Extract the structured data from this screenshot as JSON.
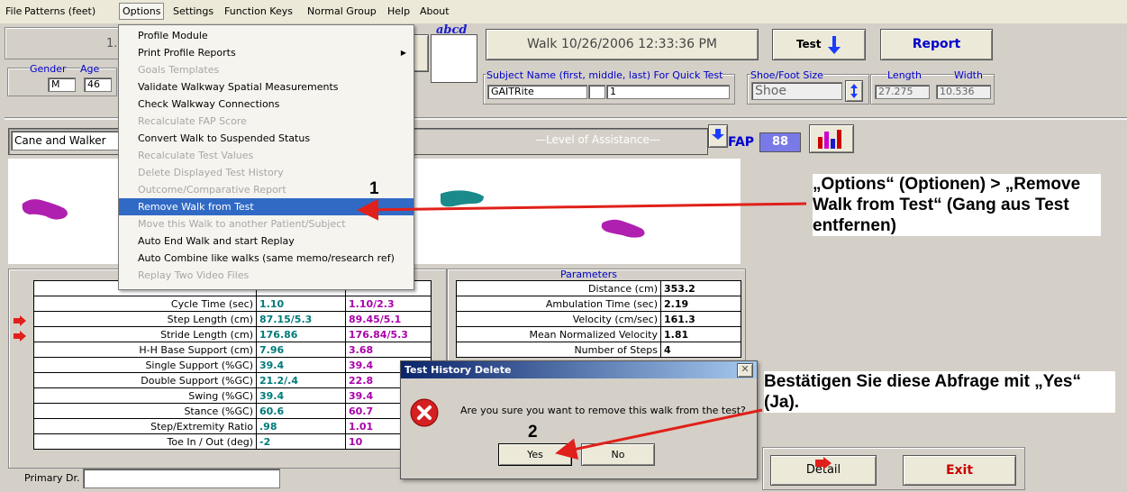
{
  "menu": [
    "File",
    "Patterns (feet)",
    "Options",
    "Settings",
    "Function Keys",
    "Normal Group",
    "Help",
    "About"
  ],
  "header": {
    "walk_title": "Walk  10/26/2006 12:33:36 PM",
    "test_button": "Test",
    "report_button": "Report",
    "abcd": "abcd",
    "partial_id": "1.",
    "gender_label": "Gender",
    "age_label": "Age",
    "gender_value": "M",
    "age_value": "46",
    "subject_label": "Subject Name (first, middle, last) For Quick Test",
    "subject_first": "GAITRite",
    "subject_middle": "",
    "subject_last": "1",
    "shoe_label": "Shoe/Foot Size",
    "shoe_value": "Shoe",
    "length_label": "Length",
    "width_label": "Width",
    "length_value": "27.275",
    "width_value": "10.536"
  },
  "assist": {
    "device": "Cane and Walker",
    "level_label": "Level of Assistance",
    "fap_label": "FAP",
    "fap_value": "88"
  },
  "options_menu": {
    "items": [
      {
        "label": "Profile Module",
        "enabled": true
      },
      {
        "label": "Print Profile Reports",
        "enabled": true
      },
      {
        "label": "Goals Templates",
        "enabled": false
      },
      {
        "label": "Validate Walkway Spatial Measurements",
        "enabled": true
      },
      {
        "label": "Check Walkway Connections",
        "enabled": true
      },
      {
        "label": "Recalculate FAP Score",
        "enabled": false
      },
      {
        "label": "Convert Walk to Suspended Status",
        "enabled": true
      },
      {
        "label": "Recalculate Test Values",
        "enabled": false
      },
      {
        "label": "Delete Displayed Test History",
        "enabled": false
      },
      {
        "label": "Outcome/Comparative Report",
        "enabled": false
      },
      {
        "label": "Remove Walk from Test",
        "enabled": true,
        "highlighted": true
      },
      {
        "label": "Move this Walk to another Patient/Subject",
        "enabled": false
      },
      {
        "label": "Auto End Walk and start Replay",
        "enabled": true
      },
      {
        "label": "Auto Combine like walks (same memo/research ref)",
        "enabled": true
      },
      {
        "label": "Replay Two Video Files",
        "enabled": false
      }
    ]
  },
  "left_table": {
    "rows": [
      {
        "label": "",
        "v1": "",
        "v2": ""
      },
      {
        "label": "Cycle Time (sec)",
        "v1": "1.10",
        "v2": "1.10/2.3"
      },
      {
        "label": "Step Length (cm)",
        "v1": "87.15/5.3",
        "v2": "89.45/5.1",
        "arrow": true
      },
      {
        "label": "Stride Length (cm)",
        "v1": "176.86",
        "v2": "176.84/5.3",
        "arrow": true
      },
      {
        "label": "H-H Base Support (cm)",
        "v1": "7.96",
        "v2": "3.68"
      },
      {
        "label": "Single Support (%GC)",
        "v1": "39.4",
        "v2": "39.4"
      },
      {
        "label": "Double Support (%GC)",
        "v1": "21.2/.4",
        "v2": "22.8"
      },
      {
        "label": "Swing (%GC)",
        "v1": "39.4",
        "v2": "39.4"
      },
      {
        "label": "Stance (%GC)",
        "v1": "60.6",
        "v2": "60.7"
      },
      {
        "label": "Step/Extremity Ratio",
        "v1": ".98",
        "v2": "1.01"
      },
      {
        "label": "Toe In / Out (deg)",
        "v1": "-2",
        "v2": "10"
      }
    ]
  },
  "params": {
    "title": "Parameters",
    "rows": [
      {
        "label": "Distance (cm)",
        "value": "353.2"
      },
      {
        "label": "Ambulation Time (sec)",
        "value": "2.19"
      },
      {
        "label": "Velocity (cm/sec)",
        "value": "161.3"
      },
      {
        "label": "Mean Normalized Velocity",
        "value": "1.81"
      },
      {
        "label": "Number of Steps",
        "value": "4"
      }
    ]
  },
  "dialog": {
    "title": "Test History Delete",
    "message": "Are you sure you want to remove this walk from the test?",
    "yes": "Yes",
    "no": "No"
  },
  "footer": {
    "primary_dr_label": "Primary Dr.",
    "detail_button": "Detail",
    "exit_button": "Exit"
  },
  "annotations": {
    "step1_number": "1",
    "step1_text": "„Options“ (Optionen) > „Remove Walk from Test“ (Gang aus Test entfernen)",
    "step2_number": "2",
    "step2_text": "Bestätigen Sie diese Abfrage mit „Yes“ (Ja)."
  },
  "colors": {
    "accent": "#0000cc",
    "highlight": "#316ac5",
    "annotation_arrow": "#e0201a",
    "footprint_left": "#b020b0",
    "footprint_right": "#1a8a8a"
  }
}
